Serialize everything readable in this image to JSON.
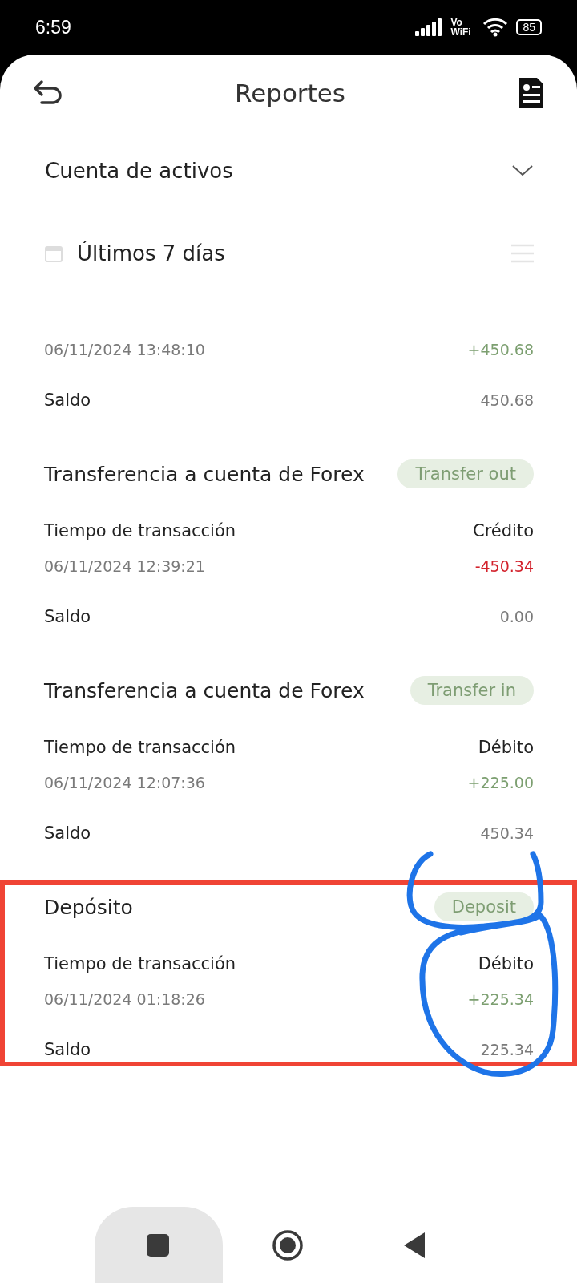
{
  "status_bar": {
    "time": "6:59",
    "network_label": "Vo WiFi",
    "battery": "85"
  },
  "header": {
    "title": "Reportes"
  },
  "account_select": {
    "value": "Cuenta de activos"
  },
  "date_filter": {
    "value": "Últimos 7 días"
  },
  "transactions": [
    {
      "time": "06/11/2024 13:48:10",
      "amount": "+450.68",
      "kind": "in",
      "balance_label": "Saldo",
      "balance": "450.68",
      "highlighted": false
    },
    {
      "title": "Transferencia a cuenta de Forex",
      "badge": "Transfer out",
      "time_label": "Tiempo de transacción",
      "amount_label": "Crédito",
      "time": "06/11/2024 12:39:21",
      "amount": "-450.34",
      "kind": "out",
      "balance_label": "Saldo",
      "balance": "0.00",
      "highlighted": false
    },
    {
      "title": "Transferencia a cuenta de Forex",
      "badge": "Transfer in",
      "time_label": "Tiempo de transacción",
      "amount_label": "Débito",
      "time": "06/11/2024 12:07:36",
      "amount": "+225.00",
      "kind": "in",
      "balance_label": "Saldo",
      "balance": "450.34",
      "highlighted": false
    },
    {
      "title": "Depósito",
      "badge": "Deposit",
      "time_label": "Tiempo de transacción",
      "amount_label": "Débito",
      "time": "06/11/2024 01:18:26",
      "amount": "+225.34",
      "kind": "in",
      "balance_label": "Saldo",
      "balance": "225.34",
      "highlighted": true
    }
  ]
}
